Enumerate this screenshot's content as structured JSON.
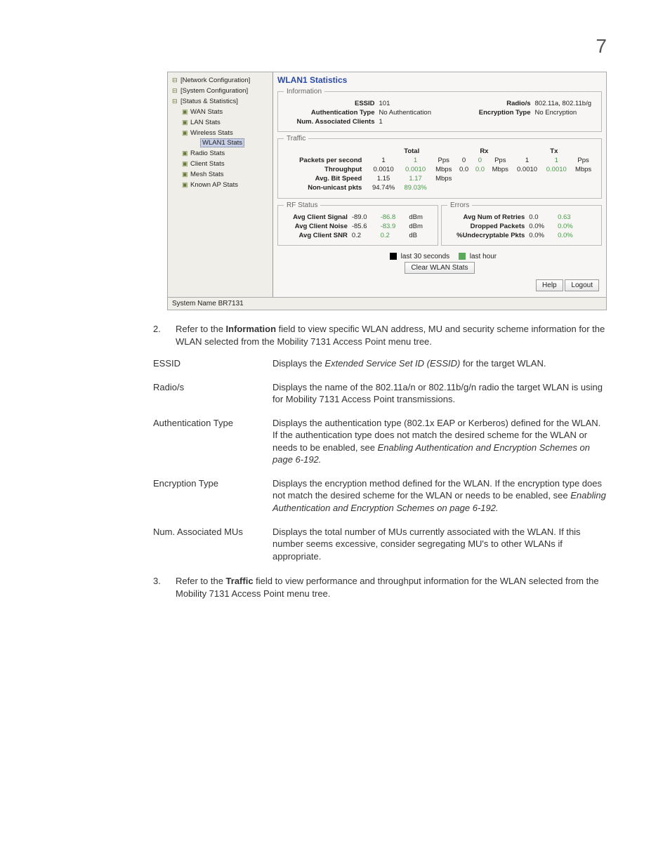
{
  "page_number": "7",
  "screenshot": {
    "tree": {
      "items": [
        {
          "label": "[Network Configuration]",
          "indent": 0,
          "icon": "⊟"
        },
        {
          "label": "[System Configuration]",
          "indent": 0,
          "icon": "⊟"
        },
        {
          "label": "[Status & Statistics]",
          "indent": 0,
          "icon": "⊟"
        },
        {
          "label": "WAN Stats",
          "indent": 1,
          "icon": "▣"
        },
        {
          "label": "LAN Stats",
          "indent": 1,
          "icon": "▣"
        },
        {
          "label": "Wireless Stats",
          "indent": 1,
          "icon": "▣"
        },
        {
          "label": "WLAN1 Stats",
          "indent": 2,
          "icon": "",
          "selected": true
        },
        {
          "label": "Radio Stats",
          "indent": 1,
          "icon": "▣"
        },
        {
          "label": "Client Stats",
          "indent": 1,
          "icon": "▣"
        },
        {
          "label": "Mesh Stats",
          "indent": 1,
          "icon": "▣"
        },
        {
          "label": "Known AP Stats",
          "indent": 1,
          "icon": "▣"
        }
      ]
    },
    "title": "WLAN1 Statistics",
    "info": {
      "legend": "Information",
      "essid_lbl": "ESSID",
      "essid_val": "101",
      "radios_lbl": "Radio/s",
      "radios_val": "802.11a, 802.11b/g",
      "auth_lbl": "Authentication Type",
      "auth_val": "No Authentication",
      "enc_lbl": "Encryption Type",
      "enc_val": "No Encryption",
      "clients_lbl": "Num. Associated Clients",
      "clients_val": "1"
    },
    "traffic": {
      "legend": "Traffic",
      "headers": {
        "total": "Total",
        "rx": "Rx",
        "tx": "Tx"
      },
      "rows": [
        {
          "label": "Packets per second",
          "t1": "1",
          "t2": "1",
          "tu": "Pps",
          "r1": "0",
          "r2": "0",
          "ru": "Pps",
          "x1": "1",
          "x2": "1",
          "xu": "Pps"
        },
        {
          "label": "Throughput",
          "t1": "0.0010",
          "t2": "0.0010",
          "tu": "Mbps",
          "r1": "0.0",
          "r2": "0.0",
          "ru": "Mbps",
          "x1": "0.0010",
          "x2": "0.0010",
          "xu": "Mbps"
        },
        {
          "label": "Avg. Bit Speed",
          "t1": "1.15",
          "t2": "1.17",
          "tu": "Mbps",
          "r1": "",
          "r2": "",
          "ru": "",
          "x1": "",
          "x2": "",
          "xu": ""
        },
        {
          "label": "Non-unicast pkts",
          "t1": "94.74%",
          "t2": "89.03%",
          "tu": "",
          "r1": "",
          "r2": "",
          "ru": "",
          "x1": "",
          "x2": "",
          "xu": ""
        }
      ]
    },
    "rf": {
      "legend": "RF Status",
      "rows": [
        {
          "label": "Avg Client Signal",
          "v1": "-89.0",
          "v2": "-86.8",
          "u": "dBm"
        },
        {
          "label": "Avg Client Noise",
          "v1": "-85.6",
          "v2": "-83.9",
          "u": "dBm"
        },
        {
          "label": "Avg Client SNR",
          "v1": "0.2",
          "v2": "0.2",
          "u": "dB"
        }
      ]
    },
    "errors": {
      "legend": "Errors",
      "rows": [
        {
          "label": "Avg Num of Retries",
          "v1": "0.0",
          "v2": "0.63"
        },
        {
          "label": "Dropped Packets",
          "v1": "0.0%",
          "v2": "0.0%"
        },
        {
          "label": "%Undecryptable Pkts",
          "v1": "0.0%",
          "v2": "0.0%"
        }
      ]
    },
    "legend_labels": {
      "black": "last 30 seconds",
      "green": "last hour"
    },
    "clear_btn": "Clear WLAN Stats",
    "help_btn": "Help",
    "logout_btn": "Logout",
    "status_bar": "System Name BR7131"
  },
  "body": {
    "para2_num": "2.",
    "para2_a": "Refer to the ",
    "para2_b": "Information",
    "para2_c": " field to view specific WLAN address, MU and security scheme information for the WLAN selected from the Mobility 7131 Access Point menu tree.",
    "defs": [
      {
        "term": "ESSID",
        "desc_a": "Displays the ",
        "desc_i": "Extended Service Set ID (ESSID)",
        "desc_b": " for the target WLAN."
      },
      {
        "term": "Radio/s",
        "desc_a": "Displays the name of the 802.11a/n or 802.11b/g/n radio the target WLAN is using for Mobility 7131 Access Point transmissions.",
        "desc_i": "",
        "desc_b": ""
      },
      {
        "term": "Authentication Type",
        "desc_a": "Displays the authentication type (802.1x EAP or Kerberos) defined for the WLAN. If the authentication type does not match the desired scheme for the WLAN or needs to be enabled, see ",
        "desc_i": "Enabling Authentication and Encryption Schemes on page 6-192.",
        "desc_b": ""
      },
      {
        "term": "Encryption Type",
        "desc_a": "Displays the encryption method defined for the WLAN. If the encryption type does not match the desired scheme for the WLAN or needs to be enabled, see ",
        "desc_i": "Enabling Authentication and Encryption Schemes on page 6-192.",
        "desc_b": ""
      },
      {
        "term": "Num. Associated MUs",
        "desc_a": "Displays the total number of MUs currently associated with the WLAN. If this number seems excessive, consider segregating MU's to other WLANs if appropriate.",
        "desc_i": "",
        "desc_b": ""
      }
    ],
    "para3_num": "3.",
    "para3_a": "Refer to the ",
    "para3_b": "Traffic",
    "para3_c": " field to view performance and throughput information for the WLAN selected from the Mobility 7131 Access Point menu tree."
  }
}
